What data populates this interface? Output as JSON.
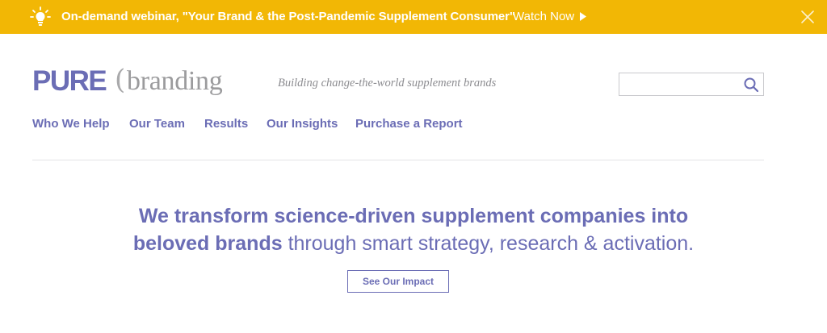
{
  "promo": {
    "text": "On-demand webinar, \"Your Brand & the Post-Pandemic Supplement Consumer\"",
    "cta": "Watch Now",
    "icons": {
      "bulb": "lightbulb-icon",
      "arrow": "play-triangle-icon",
      "close": "close-icon"
    },
    "background_color": "#f2b705",
    "text_color": "#ffffff"
  },
  "logo": {
    "pure": "PURE",
    "paren": "(",
    "branding": "branding"
  },
  "tagline": "Building change-the-world supplement brands",
  "search": {
    "value": "",
    "placeholder": "",
    "icon": "search-icon"
  },
  "nav": {
    "items": [
      {
        "label": "Who We Help"
      },
      {
        "label": "Our Team"
      },
      {
        "label": "Results"
      },
      {
        "label": "Our Insights"
      },
      {
        "label": "Purchase a Report"
      }
    ]
  },
  "hero": {
    "line1": "We transform science-driven supplement companies into",
    "line2_bold": "beloved brands",
    "line2_regular": " through smart strategy, research & activation."
  },
  "cta": {
    "label": "See Our Impact"
  },
  "colors": {
    "brand": "#6b6db5",
    "accent": "#f2b705",
    "logo_gray": "#9b9b9d"
  }
}
